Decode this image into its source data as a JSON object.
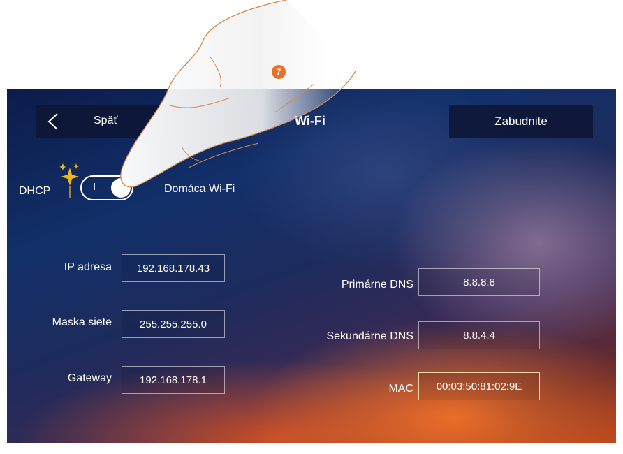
{
  "header": {
    "back_label": "Späť",
    "title": "Wi-Fi",
    "forget_label": "Zabudnite"
  },
  "dhcp": {
    "label": "DHCP",
    "toggle_on_mark": "I",
    "enabled": true
  },
  "network": {
    "ssid": "Domáca Wi-Fi"
  },
  "fields": {
    "ip": {
      "label": "IP adresa",
      "value": "192.168.178.43"
    },
    "mask": {
      "label": "Maska siete",
      "value": "255.255.255.0"
    },
    "gateway": {
      "label": "Gateway",
      "value": "192.168.178.1"
    },
    "dns1": {
      "label": "Primárne DNS",
      "value": "8.8.8.8"
    },
    "dns2": {
      "label": "Sekundárne DNS",
      "value": "8.8.4.4"
    },
    "mac": {
      "label": "MAC",
      "value": "00:03:50:81:02:9E"
    }
  },
  "step_badge": "7",
  "icons": {
    "back": "chevron-left-icon",
    "dhcp": "sparkle-icon"
  },
  "colors": {
    "accent": "#e8702a",
    "header_bg": "#0e1634",
    "mac_border": "#ffd9a0"
  }
}
